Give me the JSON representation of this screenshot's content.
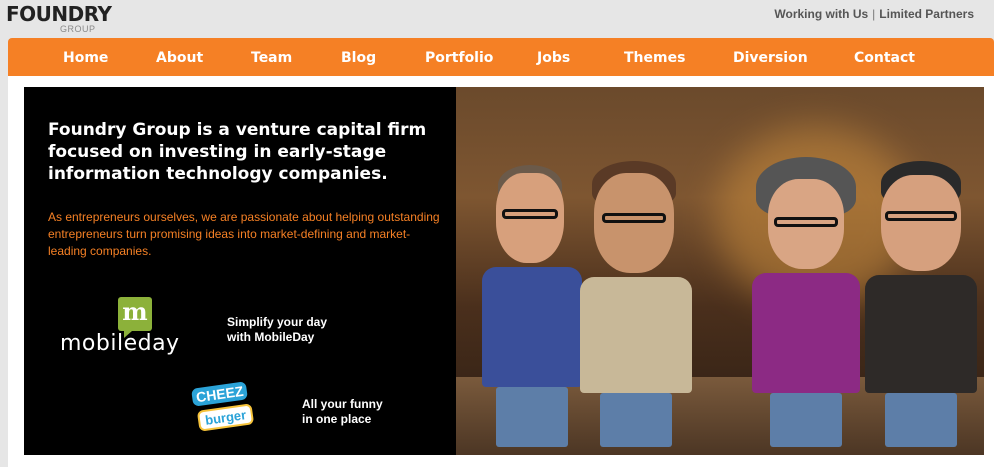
{
  "brand": {
    "name": "FOUNDRY",
    "sub": "GROUP"
  },
  "top_links": {
    "working": "Working with Us",
    "separator": "|",
    "partners": "Limited Partners"
  },
  "nav": {
    "items": [
      "Home",
      "About",
      "Team",
      "Blog",
      "Portfolio",
      "Jobs",
      "Themes",
      "Diversion",
      "Contact"
    ]
  },
  "hero": {
    "headline": "Foundry Group is a venture capital firm focused on investing in early-stage information technology companies.",
    "subtext": "As entrepreneurs ourselves, we are passionate about helping outstanding entrepreneurs turn promising ideas into market-defining and market-leading companies.",
    "promos": [
      {
        "logo_badge": "m",
        "logo_word": "mobileday",
        "line1": "Simplify your day",
        "line2": "with MobileDay"
      },
      {
        "logo_top": "CHEEZ",
        "logo_bottom": "burger",
        "line1": "All your funny",
        "line2": "in one place"
      }
    ]
  },
  "colors": {
    "accent": "#f58025",
    "hero_bg": "#000000",
    "page_bg": "#e6e6e6"
  }
}
